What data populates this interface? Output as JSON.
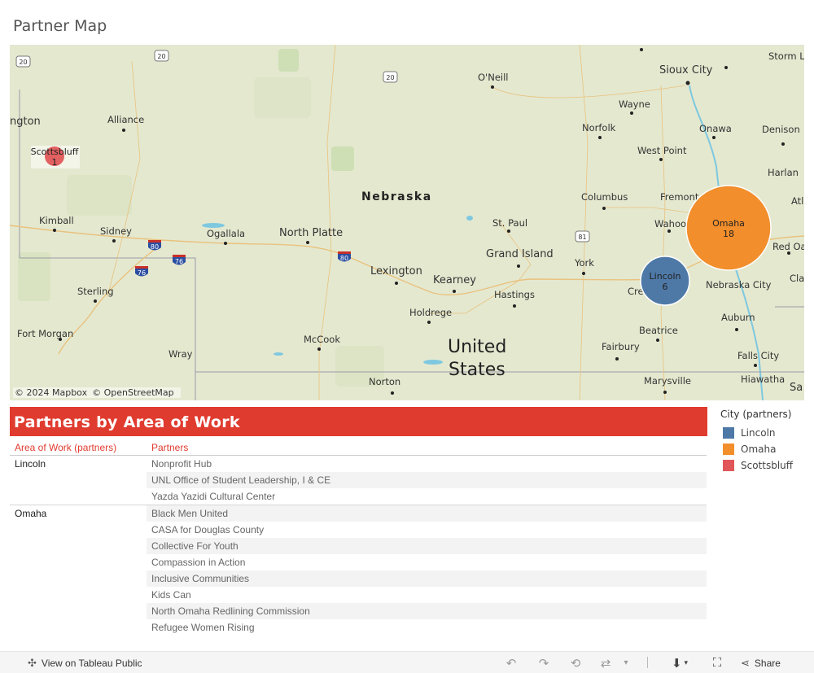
{
  "page_title": "Partner Map",
  "map": {
    "state_label": "Nebraska",
    "country_label_line1": "United",
    "country_label_line2": "States",
    "attribution": [
      "© 2024 Mapbox",
      "© OpenStreetMap"
    ],
    "cities": [
      "Sioux City",
      "O'Neill",
      "Wayne",
      "Norfolk",
      "Onawa",
      "Denison",
      "West Point",
      "Harlan",
      "Alliance",
      "Columbus",
      "Fremont",
      "Wahoo",
      "St. Paul",
      "Kimball",
      "Sidney",
      "Ogallala",
      "North Platte",
      "Grand Island",
      "York",
      "Red Oa",
      "Lexington",
      "Kearney",
      "Hastings",
      "Nebraska City",
      "Cla",
      "Sterling",
      "Holdrege",
      "Auburn",
      "Beatrice",
      "Fort Morgan",
      "McCook",
      "Fairbury",
      "Falls City",
      "Wray",
      "Norton",
      "Marysville",
      "Hiawatha",
      "Storm L",
      "ngton",
      "Atl",
      "Sa",
      "Cre"
    ],
    "highway_shields": [
      "20",
      "20",
      "20",
      "80",
      "76",
      "76",
      "80",
      "81"
    ],
    "bubbles": [
      {
        "city": "Scottsbluff",
        "partners": 1,
        "color": "#e15759"
      },
      {
        "city": "Omaha",
        "partners": 18,
        "color": "#f28e2b"
      },
      {
        "city": "Lincoln",
        "partners": 6,
        "color": "#4e79a7"
      }
    ]
  },
  "table": {
    "title": "Partners by Area of Work",
    "col_area": "Area of Work (partners)",
    "col_partners": "Partners",
    "groups": [
      {
        "area": "Lincoln",
        "partners": [
          "Nonprofit Hub",
          "UNL Office of Student Leadership, I & CE",
          "Yazda Yazidi Cultural Center"
        ]
      },
      {
        "area": "Omaha",
        "partners": [
          "Black Men United",
          "CASA for Douglas County",
          "Collective For Youth",
          "Compassion in Action",
          "Inclusive Communities",
          "Kids Can",
          "North Omaha Redlining Commission",
          "Refugee Women Rising"
        ]
      }
    ]
  },
  "legend": {
    "title": "City (partners)",
    "items": [
      {
        "label": "Lincoln",
        "color": "#4e79a7"
      },
      {
        "label": "Omaha",
        "color": "#f28e2b"
      },
      {
        "label": "Scottsbluff",
        "color": "#e15759"
      }
    ]
  },
  "footer": {
    "view_label": "View on Tableau Public",
    "share_label": "Share",
    "icons": [
      "undo-icon",
      "redo-icon",
      "revert-icon",
      "refresh-icon",
      "dropdown-icon",
      "download-icon",
      "fullscreen-icon",
      "share-icon"
    ]
  }
}
